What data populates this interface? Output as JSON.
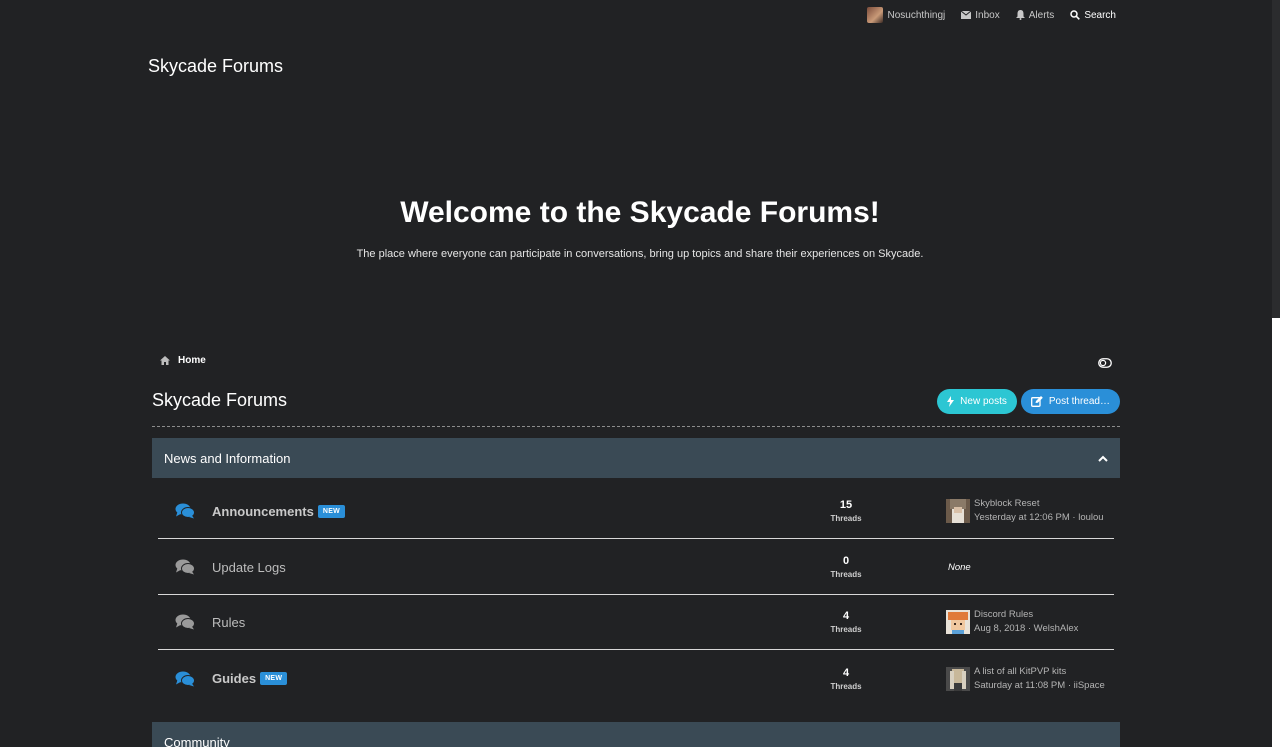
{
  "topnav": {
    "username": "Nosuchthingj",
    "inbox": "Inbox",
    "alerts": "Alerts",
    "search": "Search"
  },
  "site": {
    "title": "Skycade Forums"
  },
  "hero": {
    "heading": "Welcome to the Skycade Forums!",
    "subtitle": "The place where everyone can participate in conversations, bring up topics and share their experiences on Skycade."
  },
  "breadcrumb": {
    "home": "Home"
  },
  "page": {
    "title": "Skycade Forums"
  },
  "actions": {
    "new_posts": "New posts",
    "post_thread": "Post thread…"
  },
  "sections": [
    {
      "title": "News and Information",
      "forums": [
        {
          "name": "Announcements",
          "badge": "NEW",
          "threads": "15",
          "threads_label": "Threads",
          "last_title": "Skyblock Reset",
          "last_meta": "Yesterday at 12:06 PM · loulou"
        },
        {
          "name": "Update Logs",
          "threads": "0",
          "threads_label": "Threads",
          "last_none": "None"
        },
        {
          "name": "Rules",
          "threads": "4",
          "threads_label": "Threads",
          "last_title": "Discord Rules",
          "last_meta": "Aug 8, 2018 · WelshAlex"
        },
        {
          "name": "Guides",
          "badge": "NEW",
          "threads": "4",
          "threads_label": "Threads",
          "last_title": "A list of all KitPVP kits",
          "last_meta": "Saturday at 11:08 PM · iiSpace"
        }
      ]
    },
    {
      "title": "Community"
    }
  ],
  "colors": {
    "background": "#212224",
    "section_header": "#3a4a55",
    "accent_blue": "#2a8fd8",
    "accent_cyan": "#2cc6d3"
  },
  "icons": {
    "inbox": "envelope-icon",
    "alerts": "bell-icon",
    "search": "search-icon",
    "home": "home-icon",
    "forum": "comments-icon",
    "collapse": "chevron-up-icon",
    "new_posts": "bolt-icon",
    "post_thread": "edit-icon",
    "style_toggle": "toggle-icon"
  }
}
